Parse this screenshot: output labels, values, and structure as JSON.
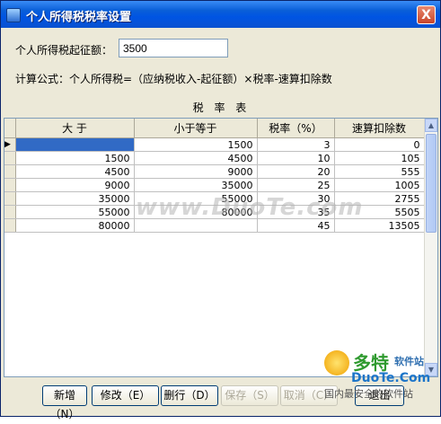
{
  "window": {
    "title": "个人所得税税率设置",
    "close_label": "X"
  },
  "threshold": {
    "label": "个人所得税起征额：",
    "value": "3500"
  },
  "formula": "计算公式：个人所得税=（应纳税收入-起征额）×税率-速算扣除数",
  "grid": {
    "title": "税 率 表",
    "columns": [
      "大 于",
      "小于等于",
      "税率（%）",
      "速算扣除数"
    ],
    "rows": [
      [
        "",
        "1500",
        "3",
        "0"
      ],
      [
        "1500",
        "4500",
        "10",
        "105"
      ],
      [
        "4500",
        "9000",
        "20",
        "555"
      ],
      [
        "9000",
        "35000",
        "25",
        "1005"
      ],
      [
        "35000",
        "55000",
        "30",
        "2755"
      ],
      [
        "55000",
        "80000",
        "35",
        "5505"
      ],
      [
        "80000",
        "",
        "45",
        "13505"
      ]
    ],
    "current_row_marker": "▶"
  },
  "buttons": {
    "add": "新增（N）",
    "edit": "修改（E）",
    "delete": "删行（D）",
    "save": "保存（S）",
    "cancel": "取消（C）",
    "exit": "退出"
  },
  "watermark": "www.DuoTe.com",
  "brand": {
    "name": "多特",
    "sub": "软件站",
    "domain": "DuoTe.Com",
    "tagline": "国内最安全的软件站"
  },
  "colors": {
    "title_bar": "#0054e3",
    "selection": "#316ac5",
    "window_bg": "#ece9d8"
  },
  "icons": [
    "app-icon",
    "close-icon",
    "row-pointer-icon",
    "scroll-up-icon",
    "scroll-down-icon"
  ]
}
